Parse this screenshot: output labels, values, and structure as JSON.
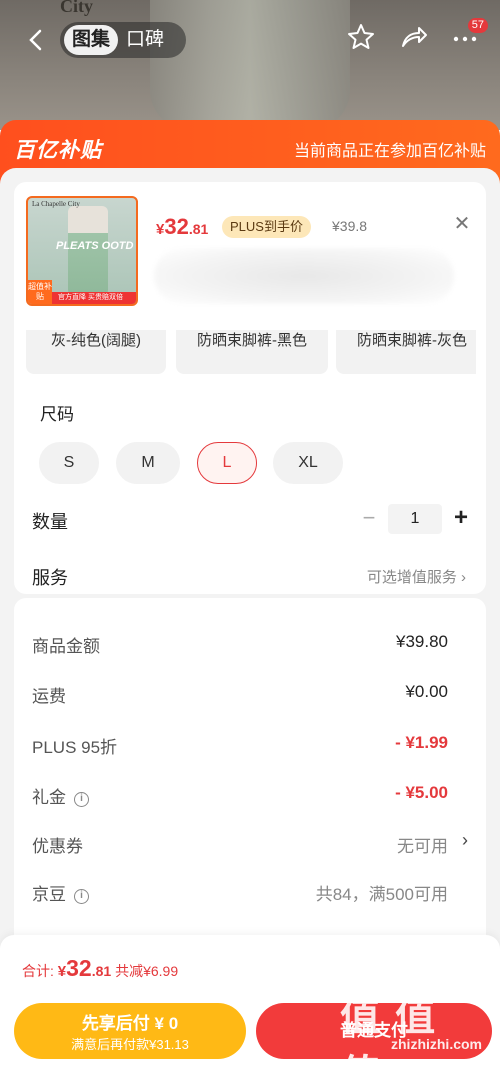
{
  "nav": {
    "photo_caption": "City",
    "tabs": [
      {
        "label": "图集",
        "active": true
      },
      {
        "label": "口碑",
        "active": false
      }
    ],
    "cart_badge": "57",
    "icons": [
      "back-icon",
      "star-icon",
      "share-icon",
      "more-icon"
    ]
  },
  "subsidy": {
    "logo": "百亿补贴",
    "note": "当前商品正在参加百亿补贴"
  },
  "product": {
    "price_symbol": "¥",
    "price_int": "32",
    "price_dec": ".81",
    "plus_tag": "PLUS到手价",
    "old_price": "¥39.8",
    "thumb": {
      "brand": "La Chapelle City",
      "title": "PLEATS OOTD",
      "tag": "超值补贴",
      "strip": "官方直降 买贵赔双倍"
    }
  },
  "colors": [
    "灰-纯色(阔腿)",
    "防晒束脚裤-黑色",
    "防晒束脚裤-灰色"
  ],
  "size": {
    "label": "尺码",
    "options": [
      "S",
      "M",
      "L",
      "XL"
    ],
    "selected": "L"
  },
  "quantity": {
    "label": "数量",
    "value": "1",
    "minus": "−",
    "plus": "+"
  },
  "service": {
    "label": "服务",
    "value": "可选增值服务 ›"
  },
  "costs": [
    {
      "name": "商品金额",
      "value": "¥39.80",
      "style": "normal"
    },
    {
      "name": "运费",
      "value": "¥0.00",
      "style": "normal"
    },
    {
      "name": "PLUS 95折",
      "value": "- ¥1.99",
      "style": "red"
    },
    {
      "name": "礼金",
      "value": "- ¥5.00",
      "style": "red",
      "info": true
    },
    {
      "name": "优惠券",
      "value": "无可用",
      "style": "gray",
      "chevron": true
    },
    {
      "name": "京豆",
      "value": "共84，满500可用",
      "style": "gray",
      "info": true
    }
  ],
  "bottom": {
    "total_label": "合计: ",
    "total_symbol": "¥",
    "total_int": "32",
    "total_dec": ".81",
    "discount": " 共减¥6.99",
    "later_line1": "先享后付 ¥ 0",
    "later_line2": "满意后再付款¥31.13",
    "pay_label": "普通支付"
  },
  "watermark": {
    "title": "值 值 值",
    "url": "zhizhizhi.com"
  },
  "colors_theme": {
    "accent": "#e4393c",
    "subsidy": "#ff5a1e",
    "later": "#ffb915"
  }
}
